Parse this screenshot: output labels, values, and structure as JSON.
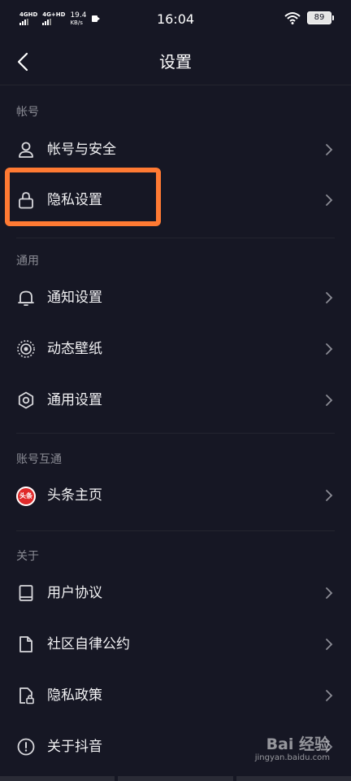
{
  "status_bar": {
    "sim1": "4GHD",
    "sim2": "4G+HD",
    "speed_value": "19.4",
    "speed_unit": "KB/s",
    "time": "16:04",
    "battery": "89"
  },
  "header": {
    "title": "设置"
  },
  "sections": [
    {
      "label": "帐号",
      "items": [
        {
          "label": "帐号与安全",
          "icon": "user-icon"
        },
        {
          "label": "隐私设置",
          "icon": "lock-icon"
        }
      ]
    },
    {
      "label": "通用",
      "items": [
        {
          "label": "通知设置",
          "icon": "bell-icon"
        },
        {
          "label": "动态壁纸",
          "icon": "wallpaper-icon"
        },
        {
          "label": "通用设置",
          "icon": "gear-icon"
        }
      ]
    },
    {
      "label": "账号互通",
      "items": [
        {
          "label": "头条主页",
          "icon": "toutiao-icon",
          "badge": "头条"
        }
      ]
    },
    {
      "label": "关于",
      "items": [
        {
          "label": "用户协议",
          "icon": "book-icon"
        },
        {
          "label": "社区自律公约",
          "icon": "document-icon"
        },
        {
          "label": "隐私政策",
          "icon": "privacy-doc-icon"
        },
        {
          "label": "关于抖音",
          "icon": "info-icon"
        }
      ]
    }
  ],
  "watermark": {
    "brand": "Bai 经验",
    "url": "jingyan.baidu.com"
  },
  "colors": {
    "background": "#161724",
    "highlight": "#ff7a33",
    "secondary_text": "#8b8c95"
  }
}
